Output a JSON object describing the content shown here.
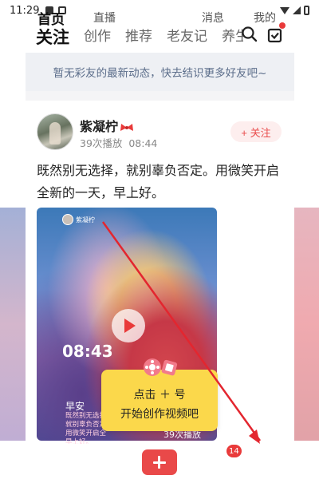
{
  "status_bar": {
    "time": "11:29"
  },
  "tabs": [
    {
      "label": "关注",
      "active": true
    },
    {
      "label": "创作"
    },
    {
      "label": "推荐"
    },
    {
      "label": "老友记"
    },
    {
      "label": "养生"
    }
  ],
  "header_icons": [
    "search-icon",
    "task-check-icon"
  ],
  "notice": "暂无彩友的最新动态，快去结识更多好友吧~",
  "post": {
    "author": "紫凝柠",
    "plays": "39次播放",
    "time": "08:44",
    "follow_label": "+ 关注",
    "text": "既然别无选择，就别辜负否定。用微笑开启全新的一天，早上好。",
    "video": {
      "author_small": "紫凝柠",
      "clock": "08:43",
      "morning": "早安",
      "small_text": "既然别无选择 就别辜负否定 用微笑开启全 早上好。",
      "play_count": "39次播放"
    }
  },
  "create_tip": {
    "line1": "点击 ＋ 号",
    "line2": "开始创作视频吧"
  },
  "bottom_nav": {
    "home": "首页",
    "live": "直播",
    "messages": "消息",
    "messages_badge": "14",
    "me": "我的"
  },
  "colors": {
    "accent": "#e93a3a",
    "tip_yellow": "#fbd84b",
    "notice_text": "#5b6d8a"
  }
}
